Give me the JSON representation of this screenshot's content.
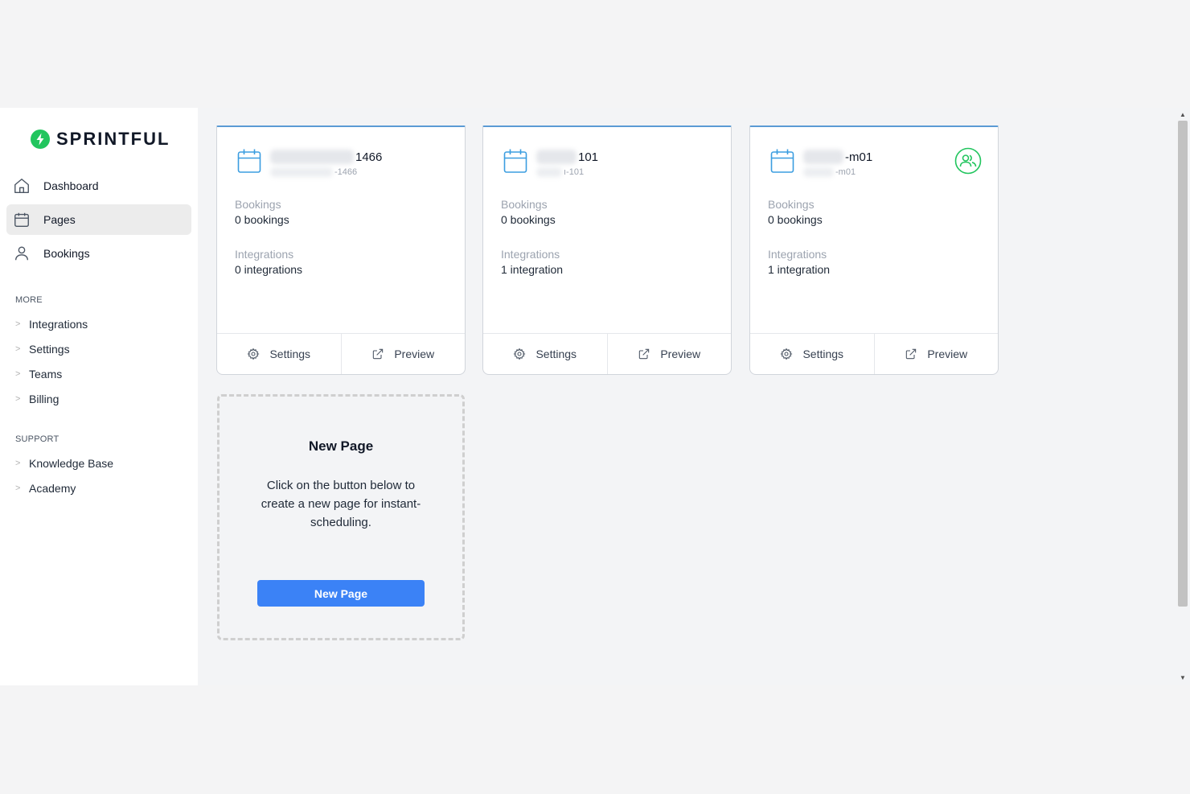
{
  "brand": {
    "name": "SPRINTFUL",
    "color": "#22c55e"
  },
  "nav": [
    {
      "label": "Dashboard",
      "icon": "home-icon",
      "active": false
    },
    {
      "label": "Pages",
      "icon": "calendar-icon",
      "active": true
    },
    {
      "label": "Bookings",
      "icon": "user-icon",
      "active": false
    }
  ],
  "more": {
    "title": "MORE",
    "items": [
      "Integrations",
      "Settings",
      "Teams",
      "Billing"
    ]
  },
  "support": {
    "title": "SUPPORT",
    "items": [
      "Knowledge Base",
      "Academy"
    ]
  },
  "cards": [
    {
      "title_suffix": "1466",
      "slug_suffix": "-1466",
      "bookings_label": "Bookings",
      "bookings_value": "0 bookings",
      "integrations_label": "Integrations",
      "integrations_value": "0 integrations",
      "settings_label": "Settings",
      "preview_label": "Preview",
      "team": false
    },
    {
      "title_suffix": "101",
      "slug_suffix": "ı-101",
      "bookings_label": "Bookings",
      "bookings_value": "0 bookings",
      "integrations_label": "Integrations",
      "integrations_value": "1 integration",
      "settings_label": "Settings",
      "preview_label": "Preview",
      "team": false
    },
    {
      "title_suffix": "-m01",
      "slug_suffix": "-m01",
      "bookings_label": "Bookings",
      "bookings_value": "0 bookings",
      "integrations_label": "Integrations",
      "integrations_value": "1 integration",
      "settings_label": "Settings",
      "preview_label": "Preview",
      "team": true
    }
  ],
  "new_page": {
    "title": "New Page",
    "description": "Click on the button below to create a new page for instant-scheduling.",
    "button_label": "New Page"
  },
  "colors": {
    "accent": "#3b82f6",
    "card_top_border": "#5b9bd5",
    "calendar_icon": "#3b9de0",
    "team_icon": "#22c55e"
  }
}
